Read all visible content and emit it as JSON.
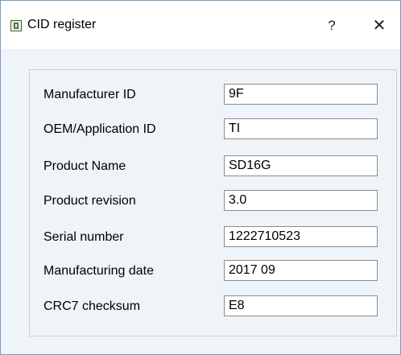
{
  "window": {
    "title": "CID register",
    "help_label": "?",
    "close_label": "✕"
  },
  "fields": [
    {
      "label": "Manufacturer ID",
      "value": "9F"
    },
    {
      "label": "OEM/Application ID",
      "value": "TI"
    },
    {
      "label": "Product Name",
      "value": "SD16G"
    },
    {
      "label": "Product revision",
      "value": "3.0"
    },
    {
      "label": "Serial number",
      "value": "1222710523"
    },
    {
      "label": "Manufacturing date",
      "value": "2017 09"
    },
    {
      "label": "CRC7 checksum",
      "value": "E8"
    }
  ],
  "icons": {
    "app": "sd-card-icon",
    "help": "help-icon",
    "close": "close-icon"
  }
}
